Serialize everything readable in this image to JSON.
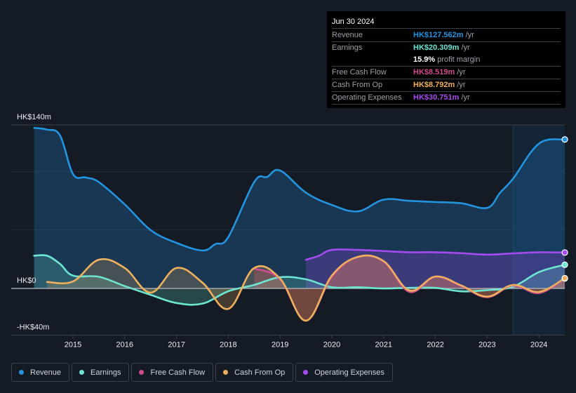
{
  "tooltip": {
    "date": "Jun 30 2024",
    "rows": [
      {
        "label": "Revenue",
        "value": "HK$127.562m",
        "unit": "/yr",
        "color": "#2394df"
      },
      {
        "label": "Earnings",
        "value": "HK$20.309m",
        "unit": "/yr",
        "color": "#6ce5d2"
      },
      {
        "label": "",
        "value": "15.9%",
        "unit": "profit margin",
        "color": "#ffffff"
      },
      {
        "label": "Free Cash Flow",
        "value": "HK$8.519m",
        "unit": "/yr",
        "color": "#d14b8f"
      },
      {
        "label": "Cash From Op",
        "value": "HK$8.792m",
        "unit": "/yr",
        "color": "#efb05e"
      },
      {
        "label": "Operating Expenses",
        "value": "HK$30.751m",
        "unit": "/yr",
        "color": "#a54cf0"
      }
    ]
  },
  "legend": [
    {
      "label": "Revenue",
      "color": "#2394df"
    },
    {
      "label": "Earnings",
      "color": "#6ce5d2"
    },
    {
      "label": "Free Cash Flow",
      "color": "#d14b8f"
    },
    {
      "label": "Cash From Op",
      "color": "#efb05e"
    },
    {
      "label": "Operating Expenses",
      "color": "#a54cf0"
    }
  ],
  "chart_data": {
    "type": "area",
    "title": "",
    "xlabel": "",
    "ylabel": "",
    "ylim": [
      -40,
      140
    ],
    "xlim": [
      2014.25,
      2024.5
    ],
    "x_ticks": [
      2015,
      2016,
      2017,
      2018,
      2019,
      2020,
      2021,
      2022,
      2023,
      2024
    ],
    "x_tick_labels": [
      "2015",
      "2016",
      "2017",
      "2018",
      "2019",
      "2020",
      "2021",
      "2022",
      "2023",
      "2024"
    ],
    "y_ticks": [
      140,
      100,
      50,
      0,
      -40
    ],
    "y_tick_labels": {
      "140": "HK$140m",
      "0": "HK$0",
      "-40": "-HK$40m"
    },
    "grid": true,
    "forecast_start": 2023.5,
    "legend_position": "bottom",
    "series": [
      {
        "name": "Revenue",
        "color": "#2394df",
        "x": [
          2014.25,
          2014.5,
          2014.75,
          2015.0,
          2015.25,
          2015.5,
          2016.0,
          2016.5,
          2017.0,
          2017.5,
          2017.75,
          2018.0,
          2018.5,
          2018.75,
          2019.0,
          2019.5,
          2020.0,
          2020.5,
          2021.0,
          2021.5,
          2022.0,
          2022.5,
          2023.0,
          2023.25,
          2023.5,
          2024.0,
          2024.5
        ],
        "values": [
          137.5,
          136,
          131,
          98,
          95,
          91,
          72,
          50,
          39,
          32.5,
          38,
          44,
          91,
          95.5,
          101,
          82,
          71.5,
          66,
          76,
          75,
          74,
          73,
          69,
          82,
          94,
          124,
          127.562
        ]
      },
      {
        "name": "Earnings",
        "color": "#6ce5d2",
        "x": [
          2014.25,
          2014.5,
          2014.75,
          2015.0,
          2015.5,
          2016.0,
          2016.5,
          2017.0,
          2017.5,
          2018.0,
          2018.5,
          2019.0,
          2019.5,
          2020.0,
          2020.5,
          2021.0,
          2021.5,
          2022.0,
          2022.5,
          2023.0,
          2023.5,
          2024.0,
          2024.5
        ],
        "values": [
          28,
          28,
          21,
          11,
          10,
          2,
          -5.5,
          -12.5,
          -13,
          -2.4,
          3,
          9.6,
          7.8,
          1,
          1,
          0,
          0.5,
          0.5,
          -2.5,
          -1.5,
          1.5,
          14,
          20.309
        ]
      },
      {
        "name": "Free Cash Flow",
        "color": "#d14b8f",
        "x": [
          2018.5,
          2019.0,
          2019.5,
          2020.0,
          2020.5,
          2021.0,
          2021.5,
          2022.0,
          2022.5,
          2023.0,
          2023.5,
          2024.0,
          2024.5
        ],
        "values": [
          17,
          8,
          -27.6,
          10,
          27,
          23,
          -3,
          10,
          2,
          -7.5,
          2.5,
          -4,
          8.519
        ]
      },
      {
        "name": "Cash From Op",
        "color": "#efb05e",
        "x": [
          2014.5,
          2015.0,
          2015.5,
          2016.0,
          2016.5,
          2017.0,
          2017.5,
          2018.0,
          2018.5,
          2019.0,
          2019.5,
          2020.0,
          2020.5,
          2021.0,
          2021.5,
          2022.0,
          2022.5,
          2023.0,
          2023.5,
          2024.0,
          2024.5
        ],
        "values": [
          5.5,
          6,
          24.6,
          17.5,
          -3.6,
          17.5,
          5,
          -17.5,
          17.5,
          8.4,
          -27.6,
          11,
          27,
          23.4,
          -1.8,
          10.2,
          2.5,
          -7,
          3,
          -3,
          8.792
        ]
      },
      {
        "name": "Operating Expenses",
        "color": "#a54cf0",
        "x": [
          2019.5,
          2019.75,
          2020.0,
          2020.5,
          2021.0,
          2021.5,
          2022.0,
          2022.5,
          2023.0,
          2023.5,
          2024.0,
          2024.5
        ],
        "values": [
          24.5,
          28,
          33,
          33,
          32,
          31,
          31,
          30.2,
          29,
          30,
          31,
          30.751
        ]
      }
    ]
  }
}
